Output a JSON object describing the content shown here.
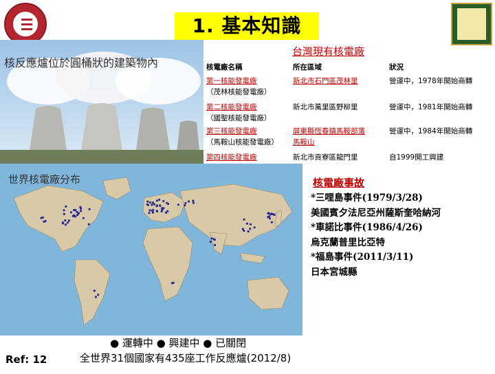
{
  "header": {
    "title": "1. 基本知識"
  },
  "photo": {
    "caption": "核反應爐位於圓桶狀的建築物內"
  },
  "plants_table": {
    "title": "台灣現有核電廠",
    "headers": {
      "name": "核電廠名稱",
      "location": "所在區域",
      "status": "狀況"
    },
    "rows": [
      {
        "name1": "第一核能發電廠",
        "name2": "（茂林核能發電廠）",
        "loc1": "新北市石門區茂林里",
        "loc2": "",
        "status": "營運中，1978年開始商轉"
      },
      {
        "name1": "第二核能發電廠",
        "name2": "（國聖核能發電廠）",
        "loc1": "新北市萬里區野柳里",
        "loc2": "",
        "status": "營運中，1981年開始商轉"
      },
      {
        "name1": "第三核能發電廠",
        "name2": "（馬鞍山核能發電廠）",
        "loc1": "屏東縣恆春鎮馬鞍部落",
        "loc2": "馬鞍山",
        "status": "營運中，1984年開始商轉"
      },
      {
        "name1": "第四核能發電廠",
        "name2": "",
        "loc1": "新北市貢寮區龍門里",
        "loc2": "",
        "status": "自1999開工興建"
      }
    ]
  },
  "accidents": {
    "title": "核電廠事故",
    "lines": [
      "*三哩島事件(1979/3/28)",
      " 美國賓夕法尼亞州薩斯奎哈納河",
      "*車諾比事件(1986/4/26)",
      " 烏克蘭普里比亞特",
      "*福島事件(2011/3/11)",
      " 日本宮城縣"
    ]
  },
  "map": {
    "caption": "世界核電廠分布",
    "legend": "● 運轉中 ● 興建中 ● 已關閉",
    "note": "全世界31個國家有435座工作反應爐(2012/8)"
  },
  "footer": {
    "ref": "Ref: 12"
  },
  "colors": {
    "accent_red": "#c00000",
    "title_highlight": "#ffff00",
    "ocean": "#7fb6d9",
    "land": "#d8c9a8",
    "plant_dot": "#2a2a9a"
  }
}
